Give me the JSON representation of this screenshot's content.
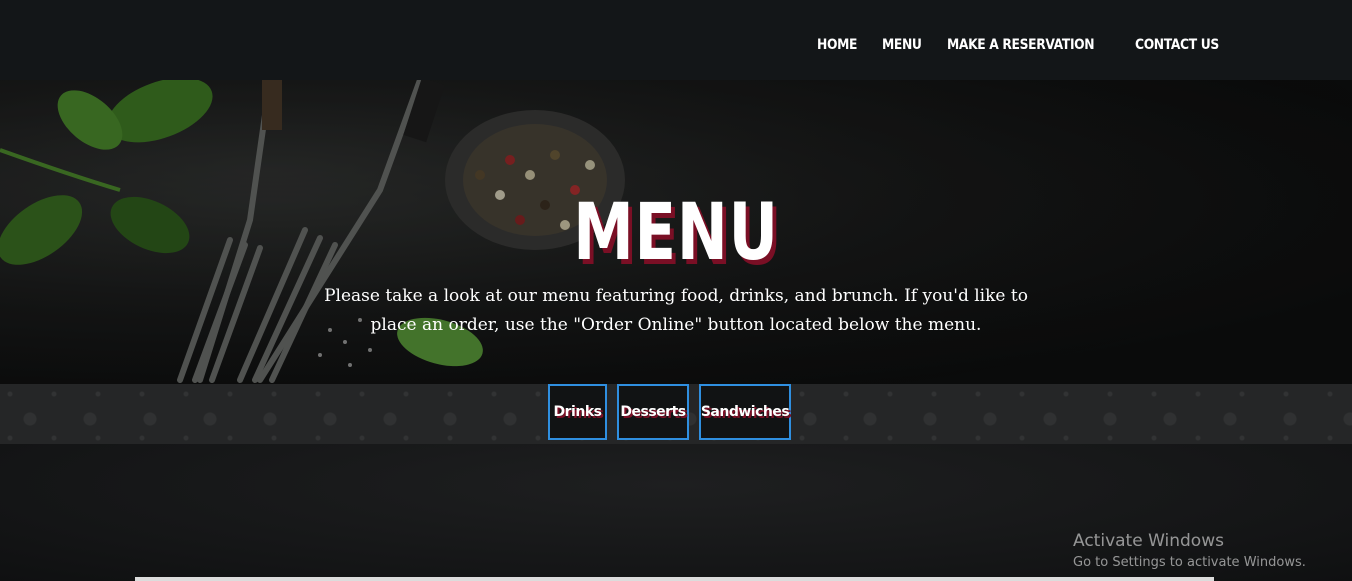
{
  "nav": {
    "items": [
      {
        "label": "HOME"
      },
      {
        "label": "MENU"
      },
      {
        "label": "MAKE A RESERVATION"
      },
      {
        "label": "CONTACT US"
      }
    ]
  },
  "hero": {
    "title": "MENU",
    "description": "Please take a look at our menu featuring food, drinks, and brunch. If you'd like to place an order, use the \"Order Online\" button located below the menu."
  },
  "tabs": [
    {
      "label": "Drinks"
    },
    {
      "label": "Desserts"
    },
    {
      "label": "Sandwiches"
    }
  ],
  "watermark": {
    "title": "Activate Windows",
    "subtitle": "Go to Settings to activate Windows."
  },
  "colors": {
    "navbar": "#131618",
    "title_shadow": "#7a0f25",
    "tab_border": "#2f8fe0"
  }
}
